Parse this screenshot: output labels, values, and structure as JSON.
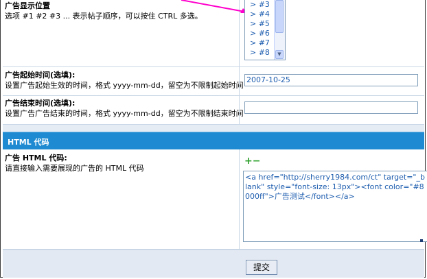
{
  "position": {
    "title": "广告显示位置",
    "desc": "选项 #1 #2 #3 ... 表示帖子顺序，可以按住 CTRL 多选。",
    "options": [
      "> #3",
      "> #4",
      "> #5",
      "> #6",
      "> #7",
      "> #8"
    ]
  },
  "start_time": {
    "title": "广告起始时间(选填):",
    "desc": "设置广告起始生效的时间，格式 yyyy-mm-dd，留空为不限制起始时间",
    "value": "2007-10-25"
  },
  "end_time": {
    "title": "广告结束时间(选填):",
    "desc": "设置广告广告结束的时间，格式 yyyy-mm-dd，留空为不限制结束时间",
    "value": ""
  },
  "html_section": {
    "header": "HTML 代码",
    "title": "广告 HTML 代码:",
    "desc": "请直接输入需要展现的广告的 HTML 代码",
    "plus": "+",
    "minus": "−",
    "code": "<a href=\"http://sherry1984.com/ct\" target=\"_blank\" style=\"font-size: 13px\"><font color=\"#8000ff\">广告测试</font></a>"
  },
  "footer": {
    "submit_label": "提交"
  },
  "colors": {
    "section_header": "#1d8ad1",
    "annotation_arrow": "#ff00cc",
    "option_text": "#1c5cae"
  }
}
